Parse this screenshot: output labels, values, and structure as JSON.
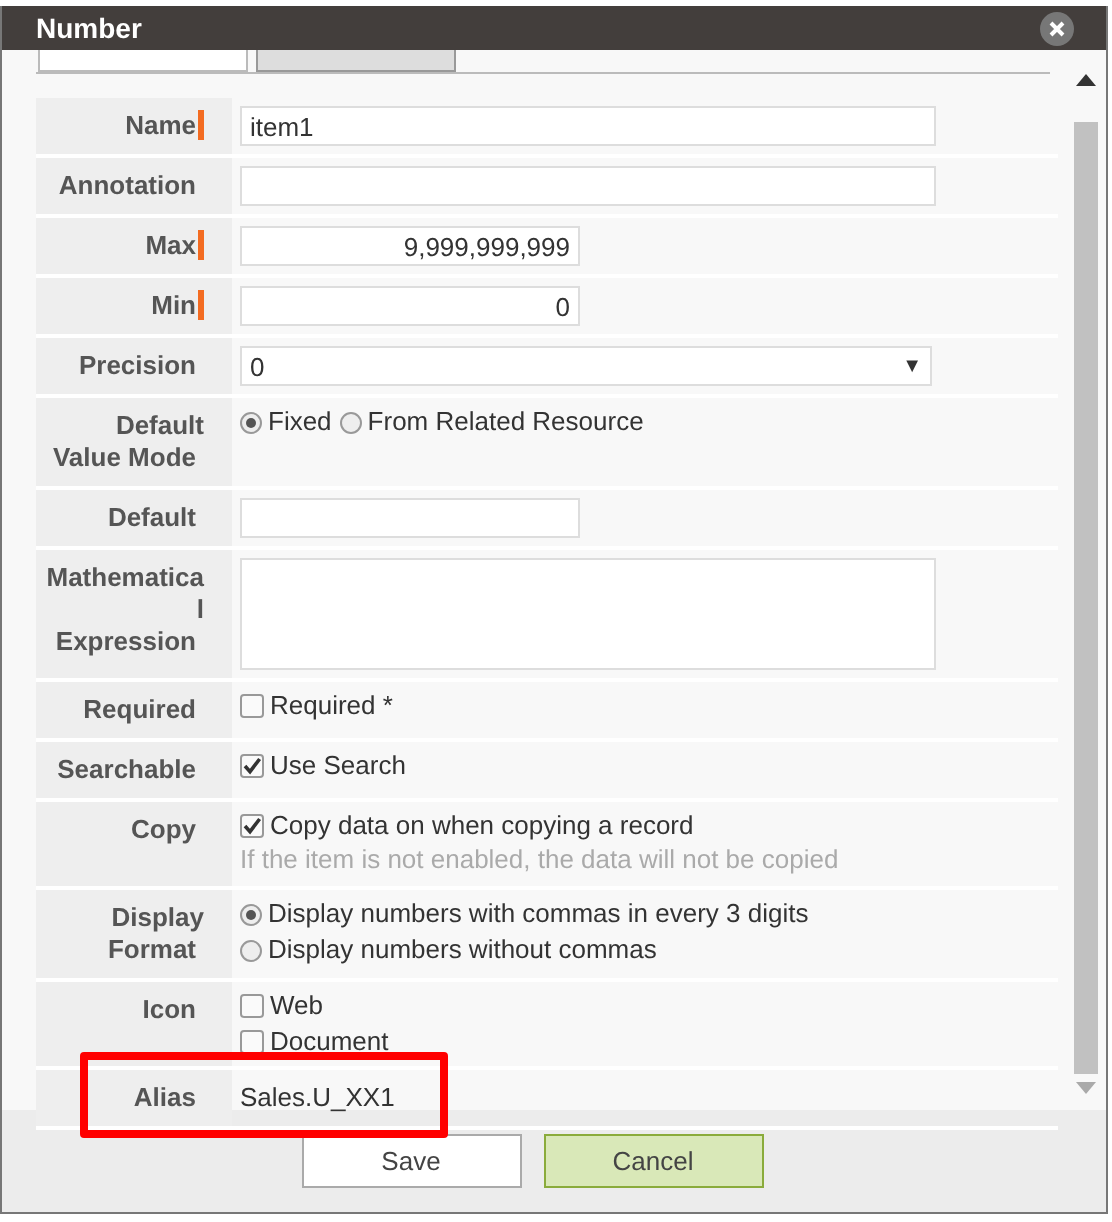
{
  "window": {
    "title": "Number"
  },
  "tabs": [
    {
      "selected": true
    },
    {
      "selected": false
    }
  ],
  "rows": [
    {
      "label": "Name",
      "required": true,
      "kind": "text",
      "value": "item1"
    },
    {
      "label": "Annotation",
      "required": false,
      "kind": "text"
    },
    {
      "label": "Max",
      "required": true,
      "kind": "number",
      "value": "9,999,999,999"
    },
    {
      "label": "Min",
      "required": true,
      "kind": "number",
      "value": "0"
    },
    {
      "label": "Precision",
      "required": false,
      "kind": "select",
      "value": "0",
      "arrow": "▼"
    },
    {
      "label": "Default Value Mode",
      "required": false,
      "kind": "radios_inline",
      "options": [
        {
          "label": "Fixed",
          "selected": true
        },
        {
          "label": "From Related Resource",
          "selected": false
        }
      ]
    },
    {
      "label": "Default",
      "required": false,
      "kind": "number"
    },
    {
      "label": "Mathematical Expression",
      "required": false,
      "kind": "textarea"
    },
    {
      "label": "Required",
      "required": false,
      "kind": "checks",
      "options": [
        {
          "label": "Required *",
          "checked": false
        }
      ]
    },
    {
      "label": "Searchable",
      "required": false,
      "kind": "checks",
      "options": [
        {
          "label": "Use Search",
          "checked": true
        }
      ]
    },
    {
      "label": "Copy",
      "required": false,
      "kind": "checks",
      "options": [
        {
          "label": "Copy data on when copying a record",
          "checked": true
        }
      ],
      "note": "If the item is not enabled, the data will not be copied"
    },
    {
      "label": "Display Format",
      "required": false,
      "kind": "radios",
      "options": [
        {
          "label": "Display numbers with commas in every 3 digits",
          "selected": true
        },
        {
          "label": "Display numbers without commas",
          "selected": false
        }
      ]
    },
    {
      "label": "Icon",
      "required": false,
      "kind": "checks",
      "options": [
        {
          "label": "Web",
          "checked": false
        },
        {
          "label": "Document",
          "checked": false
        }
      ]
    },
    {
      "label": "Alias",
      "required": false,
      "kind": "plain",
      "value": "Sales.U_XX1",
      "highlighted": true
    }
  ],
  "buttons": [
    {
      "label": "Save",
      "primary": false
    },
    {
      "label": "Cancel",
      "primary": true
    }
  ]
}
